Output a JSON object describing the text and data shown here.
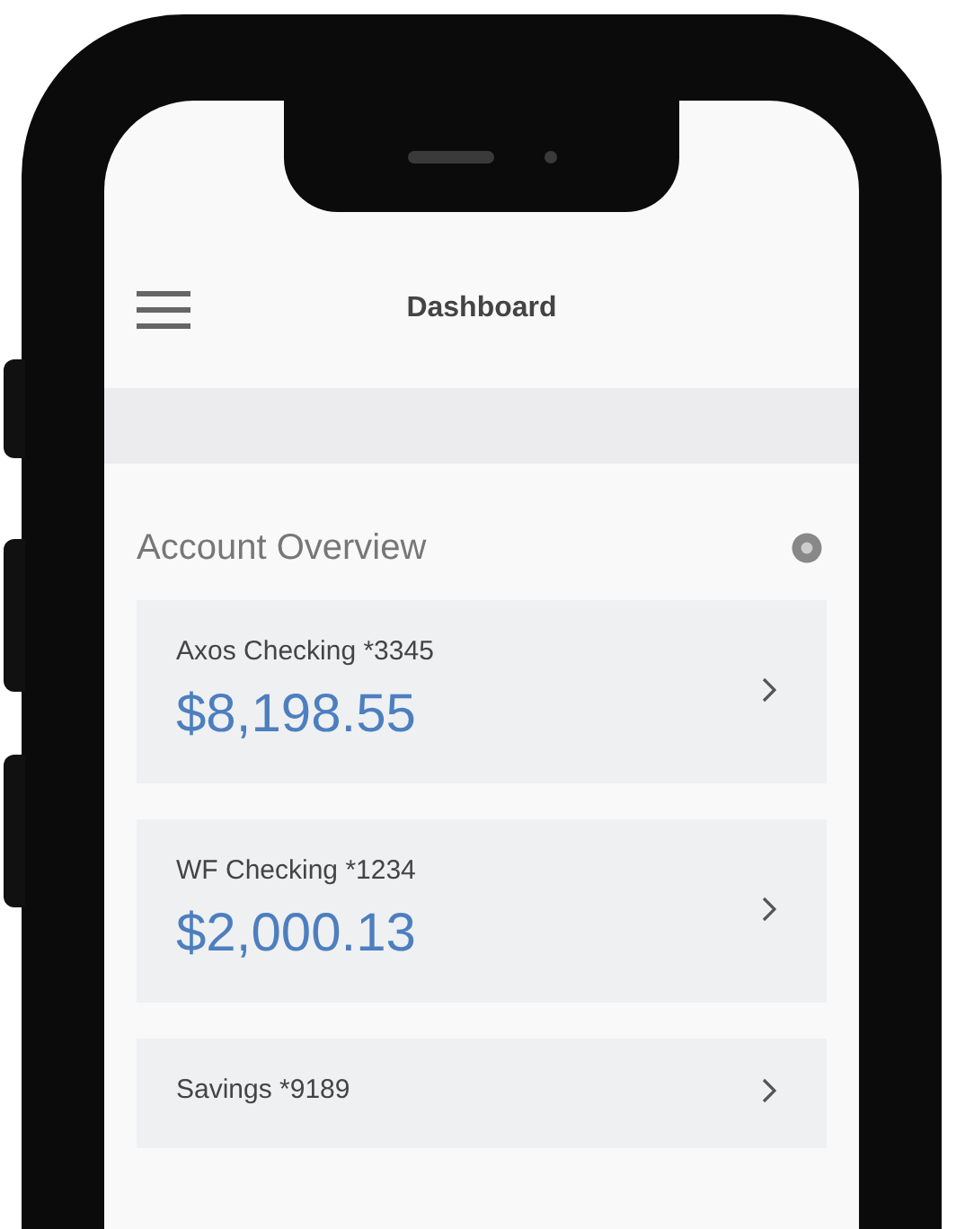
{
  "header": {
    "title": "Dashboard"
  },
  "section": {
    "title": "Account Overview"
  },
  "accounts": [
    {
      "name": "Axos Checking *3345",
      "balance": "$8,198.55"
    },
    {
      "name": "WF Checking *1234",
      "balance": "$2,000.13"
    },
    {
      "name": "Savings *9189"
    }
  ]
}
